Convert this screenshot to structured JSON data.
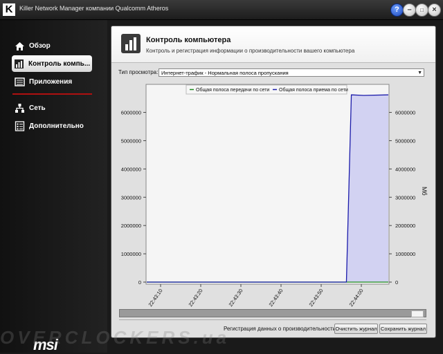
{
  "window": {
    "title": "Killer Network Manager компании Qualcomm Atheros",
    "logo": "K"
  },
  "sidebar": {
    "items": [
      {
        "label": "Обзор",
        "icon": "home-icon",
        "active": false
      },
      {
        "label": "Контроль компь...",
        "icon": "bar-chart-icon",
        "active": true
      },
      {
        "label": "Приложения",
        "icon": "applications-icon",
        "active": false
      },
      {
        "label": "Сеть",
        "icon": "network-icon",
        "active": false
      },
      {
        "label": "Дополнительно",
        "icon": "list-icon",
        "active": false
      }
    ],
    "brand": "msi"
  },
  "header": {
    "title": "Контроль компьютера",
    "subtitle": "Контроль и регистрация информации о производительности вашего компьютера"
  },
  "view": {
    "label": "Тип просмотра:",
    "selected": "Интернет-трафик - Нормальная полоса пропускания"
  },
  "chart_data": {
    "type": "area",
    "title": "",
    "xlabel": "",
    "ylabel": "",
    "y2label": "Мб",
    "ylim": [
      0,
      6600000
    ],
    "yticks": [
      0,
      1000000,
      2000000,
      3000000,
      4000000,
      5000000,
      6000000
    ],
    "ytick_labels": [
      "0",
      "1000000",
      "2000000",
      "3000000",
      "4000000",
      "5000000",
      "6000000"
    ],
    "xticks": [
      "22:43:10",
      "22:43:20",
      "22:43:30",
      "22:43:40",
      "22:43:50",
      "22:44:00"
    ],
    "xlim": [
      0,
      49
    ],
    "grid": false,
    "legend_position": "top",
    "series": [
      {
        "name": "Общая полоса передачи по сети",
        "color": "#1a8a1a",
        "x": [
          0,
          49
        ],
        "y": [
          0,
          0
        ]
      },
      {
        "name": "Общая полоса приема по сети",
        "color": "#1a1aaa",
        "fill": "#d2d2f2",
        "x": [
          0,
          40.5,
          41.5,
          44,
          49
        ],
        "y": [
          0,
          0,
          6620000,
          6600000,
          6620000
        ]
      }
    ]
  },
  "log": {
    "label": "Регистрация данных о производительности:",
    "clear_button": "Очистить журнал",
    "save_button": "Сохранить журнал"
  },
  "watermark": "OVERCLOCKERS.ua",
  "colors": {
    "accent_red": "#b01010",
    "active_nav": "#ffffff",
    "panel_bg": "#e0e0e0"
  }
}
